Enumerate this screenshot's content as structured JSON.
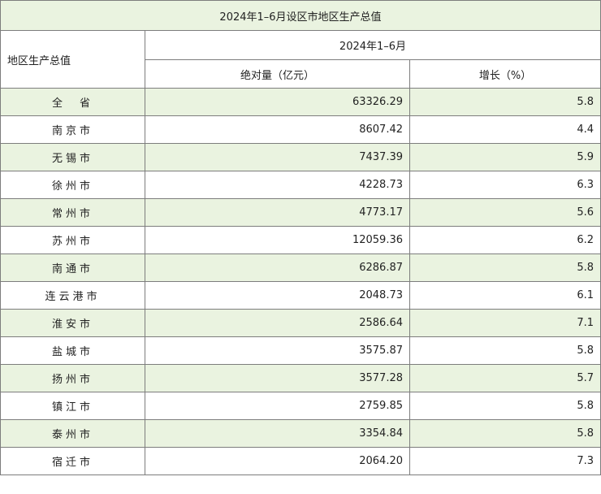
{
  "table": {
    "title": "2024年1–6月设区市地区生产总值",
    "region_header": "地区生产总值",
    "period_header": "2024年1–6月",
    "abs_header": "绝对量（亿元）",
    "growth_header": "增长（%）",
    "rows": [
      {
        "name": "全　省",
        "value": "63326.29",
        "growth": "5.8"
      },
      {
        "name": "南京市",
        "value": "8607.42",
        "growth": "4.4"
      },
      {
        "name": "无锡市",
        "value": "7437.39",
        "growth": "5.9"
      },
      {
        "name": "徐州市",
        "value": "4228.73",
        "growth": "6.3"
      },
      {
        "name": "常州市",
        "value": "4773.17",
        "growth": "5.6"
      },
      {
        "name": "苏州市",
        "value": "12059.36",
        "growth": "6.2"
      },
      {
        "name": "南通市",
        "value": "6286.87",
        "growth": "5.8"
      },
      {
        "name": "连云港市",
        "value": "2048.73",
        "growth": "6.1"
      },
      {
        "name": "淮安市",
        "value": "2586.64",
        "growth": "7.1"
      },
      {
        "name": "盐城市",
        "value": "3575.87",
        "growth": "5.8"
      },
      {
        "name": "扬州市",
        "value": "3577.28",
        "growth": "5.7"
      },
      {
        "name": "镇江市",
        "value": "2759.85",
        "growth": "5.8"
      },
      {
        "name": "泰州市",
        "value": "3354.84",
        "growth": "5.8"
      },
      {
        "name": "宿迁市",
        "value": "2064.20",
        "growth": "7.3"
      }
    ]
  }
}
